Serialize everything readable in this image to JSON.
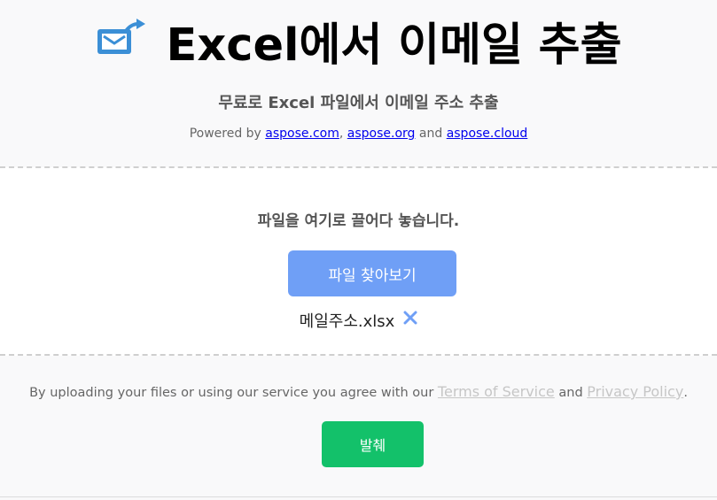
{
  "header": {
    "title": "Excel에서 이메일 추출",
    "subtitle": "무료로 Excel 파일에서 이메일 주소 추출",
    "powered_prefix": "Powered by ",
    "links": [
      "aspose.com",
      "aspose.org",
      "aspose.cloud"
    ],
    "separator": ", ",
    "and_text": " and ",
    "logo_icon": "email-export-icon"
  },
  "upload": {
    "drop_text": "파일을 여기로 끌어다 놓습니다.",
    "browse_label": "파일 찾아보기",
    "file_name": "메일주소.xlsx",
    "remove_icon": "close-icon"
  },
  "footer": {
    "terms_prefix": "By uploading your files or using our service you agree with our ",
    "terms_link": "Terms of Service",
    "and_text": " and ",
    "privacy_link": "Privacy Policy",
    "terms_suffix": ".",
    "convert_label": "발췌"
  },
  "colors": {
    "browse_button": "#6f9ff6",
    "convert_button": "#13c16a",
    "logo_blue": "#3b8fd6",
    "remove_icon": "#6f9ff6"
  }
}
